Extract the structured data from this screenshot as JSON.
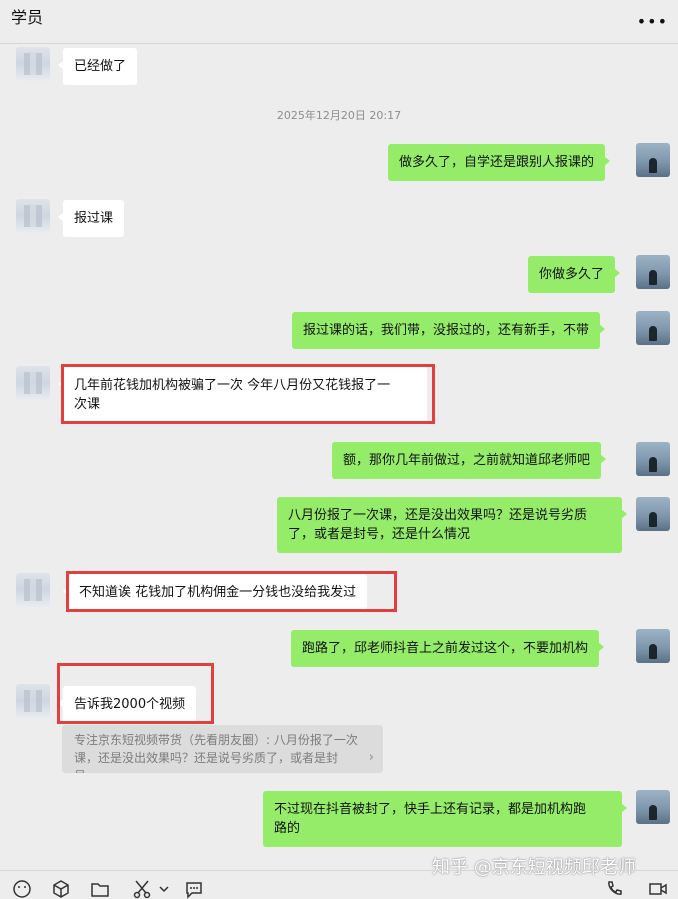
{
  "header": {
    "title": "学员",
    "more_icon": "more-icon"
  },
  "timestamp": "2025年12月20日 20:17",
  "messages": [
    {
      "side": "left",
      "text": "已经做了"
    },
    {
      "side": "right",
      "text": "做多久了，自学还是跟别人报课的"
    },
    {
      "side": "left",
      "text": "报过课"
    },
    {
      "side": "right",
      "text": "你做多久了"
    },
    {
      "side": "right",
      "text": "报过课的话，我们带，没报过的，还有新手，不带"
    },
    {
      "side": "left",
      "text": "几年前花钱加机构被骗了一次 今年八月份又花钱报了一\n次课"
    },
    {
      "side": "right",
      "text": "额，那你几年前做过，之前就知道邱老师吧"
    },
    {
      "side": "right",
      "text": "八月份报了一次课，还是没出效果吗？还是说号劣质\n了，或者是封号，还是什么情况"
    },
    {
      "side": "left",
      "text": "不知道诶 花钱加了机构佣金一分钱也没给我发过"
    },
    {
      "side": "right",
      "text": "跑路了，邱老师抖音上之前发过这个，不要加机构"
    },
    {
      "side": "left",
      "text": "告诉我2000个视频"
    },
    {
      "side": "right",
      "text": "不过现在抖音被封了，快手上还有记录，都是加机构跑\n路的"
    }
  ],
  "quote": {
    "text": "专注京东短视频带货（先看朋友圈）: 八月份报了一次课，还是没出效果吗？还是说号劣质了，或者是封号…",
    "arrow": "›"
  },
  "watermark": "知乎 @京东短视频邱老师",
  "toolbar": [
    "emoji-icon",
    "favorites-icon",
    "folder-icon",
    "scissors-icon",
    "chevron-down-icon",
    "chat-history-icon",
    "phone-icon",
    "video-call-icon"
  ],
  "colors": {
    "background": "#ededed",
    "self_bubble": "#95ec69",
    "other_bubble": "#ffffff",
    "highlight_box": "#e0413f"
  }
}
